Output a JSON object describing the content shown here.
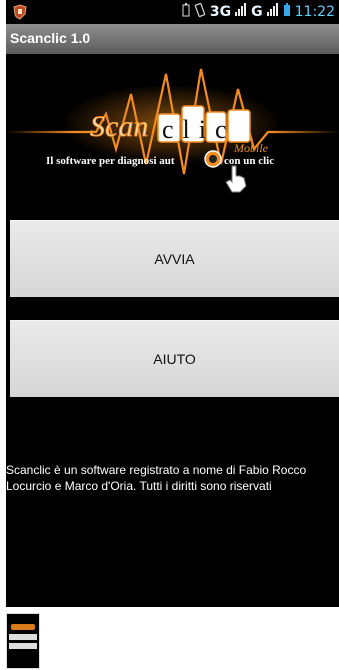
{
  "status_bar": {
    "network_1": "3G",
    "network_2": "G",
    "time": "11:22",
    "icons": [
      "app-shield-icon",
      "battery-icon",
      "vibrate-icon",
      "signal-icon",
      "signal-icon",
      "battery-level-icon"
    ]
  },
  "app": {
    "title": "Scanclic 1.0"
  },
  "logo": {
    "brand_left": "Scan",
    "brand_right": "clic",
    "badge": "Mobile",
    "tagline_left": "Il software per diagnosi aut",
    "tagline_right": "con un clic",
    "accent_color": "#f28c1e"
  },
  "buttons": {
    "start_label": "AVVIA",
    "help_label": "AIUTO"
  },
  "footer": {
    "text": "Scanclic è un software registrato a nome di Fabio Rocco Locurcio e Marco d'Oria. Tutti i diritti sono riservati"
  }
}
